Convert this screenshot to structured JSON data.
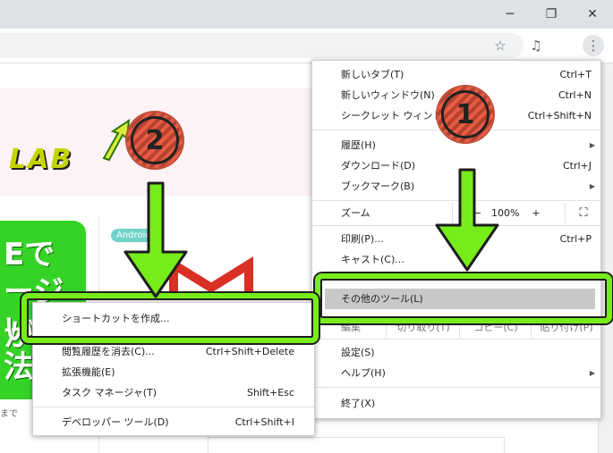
{
  "window": {
    "minimize_glyph": "─",
    "restore_glyph": "❐",
    "close_glyph": "✕"
  },
  "toolbar": {
    "star_glyph": "☆",
    "media_glyph": "♫",
    "menu_glyph": "⋮"
  },
  "webpage": {
    "logo_text": "LAB",
    "green_lines": [
      "Eで",
      "ージが",
      "い",
      "法"
    ],
    "tag_label": "Android",
    "small_text": "まで"
  },
  "main_menu": {
    "items": [
      {
        "label": "新しいタブ(T)",
        "shortcut": "Ctrl+T"
      },
      {
        "label": "新しいウィンドウ(N)",
        "shortcut": "Ctrl+N"
      },
      {
        "label": "シークレット ウィンドウを開く(I)",
        "shortcut": "Ctrl+Shift+N"
      },
      {
        "label": "履歴(H)",
        "shortcut": ""
      },
      {
        "label": "ダウンロード(D)",
        "shortcut": "Ctrl+J"
      },
      {
        "label": "ブックマーク(B)",
        "shortcut": ""
      },
      {
        "label": "印刷(P)...",
        "shortcut": "Ctrl+P"
      },
      {
        "label": "キャスト(C)...",
        "shortcut": ""
      },
      {
        "label": "その他のツール(L)",
        "shortcut": ""
      },
      {
        "label": "設定(S)",
        "shortcut": ""
      },
      {
        "label": "ヘルプ(H)",
        "shortcut": ""
      },
      {
        "label": "終了(X)",
        "shortcut": ""
      }
    ],
    "zoom": {
      "label": "ズーム",
      "minus": "−",
      "value": "100%",
      "plus": "+",
      "fullscreen_glyph": "⛶"
    },
    "edit": {
      "label": "編集",
      "cut": "切り取り(T)",
      "copy": "コピー(C)",
      "paste": "貼り付け(P)"
    }
  },
  "sub_menu": {
    "items": [
      {
        "label": "ショートカットを作成...",
        "shortcut": ""
      },
      {
        "label": "閲覧履歴を消去(C)...",
        "shortcut": "Ctrl+Shift+Delete"
      },
      {
        "label": "拡張機能(E)",
        "shortcut": ""
      },
      {
        "label": "タスク マネージャ(T)",
        "shortcut": "Shift+Esc"
      },
      {
        "label": "デベロッパー ツール(D)",
        "shortcut": "Ctrl+Shift+I"
      }
    ]
  },
  "annotations": {
    "step1": "1",
    "step2": "2",
    "accent": "#77ec1b",
    "circle": "#e85c44"
  }
}
